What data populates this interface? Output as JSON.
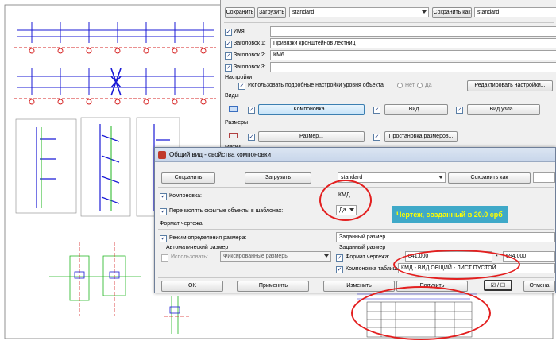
{
  "back_dialog": {
    "save_btn": "Сохранить",
    "load_btn": "Загрузить",
    "load_value": "standard",
    "save_as_btn": "Сохранить как",
    "save_as_value": "standard",
    "fields": [
      {
        "label": "Имя:",
        "value": ""
      },
      {
        "label": "Заголовок 1:",
        "value": "Привязки кронштейнов лестниц"
      },
      {
        "label": "Заголовок 2:",
        "value": "КМ6"
      },
      {
        "label": "Заголовок 3:",
        "value": ""
      }
    ],
    "settings_header": "Настройки",
    "detailed_settings_label": "Использовать подробные настройки уровня объекта",
    "radio_no": "Нет",
    "radio_yes": "Да",
    "edit_settings_btn": "Редактировать настройки...",
    "views_header": "Виды",
    "layout_btn": "Компоновка...",
    "view_btn": "Вид...",
    "node_view_btn": "Вид узла...",
    "dimensions_header": "Размеры",
    "size_btn": "Размер...",
    "dim_placement_btn": "Простановка размеров...",
    "marks_header": "Метки"
  },
  "front_dialog": {
    "title": "Общий вид - свойства компоновки",
    "save_btn": "Сохранить",
    "load_btn": "Загрузить",
    "load_value": "standard",
    "save_as_btn": "Сохранить как",
    "layout_label": "Компоновка:",
    "layout_value": "КМД",
    "list_hidden_label": "Перечислять скрытые объекты в шаблонах:",
    "list_hidden_value": "Да",
    "format_header": "Формат чертежа",
    "size_mode_label": "Режим определения размера:",
    "size_mode_value": "Заданный размер",
    "auto_size_header": "Автоматический размер",
    "use_label": "Использовать:",
    "use_value": "Фиксированные размеры",
    "given_size_header": "Заданный размер",
    "drawing_format_label": "Формат чертежа:",
    "width_value": "841.000",
    "times": "*",
    "height_value": "594.000",
    "table_layout_label": "Компоновка таблицы:",
    "table_layout_value": "КМД - ВИД ОБЩИЙ - ЛИСТ ПУСТОЙ",
    "ok_btn": "OK",
    "apply_btn": "Применить",
    "modify_btn": "Изменить",
    "get_btn": "Получить",
    "toggle_btn": "☑ / ☐",
    "cancel_btn": "Отмена"
  },
  "annotation": {
    "note_text": "Чертеж, созданный в 20.0 срб"
  },
  "colors": {
    "note_bg": "#3fa9c8",
    "note_text": "#ffff00",
    "annotation_red": "#e31f1f",
    "cad_blue": "#1a1ad6",
    "cad_red": "#d62020",
    "cad_green": "#1db51d"
  }
}
